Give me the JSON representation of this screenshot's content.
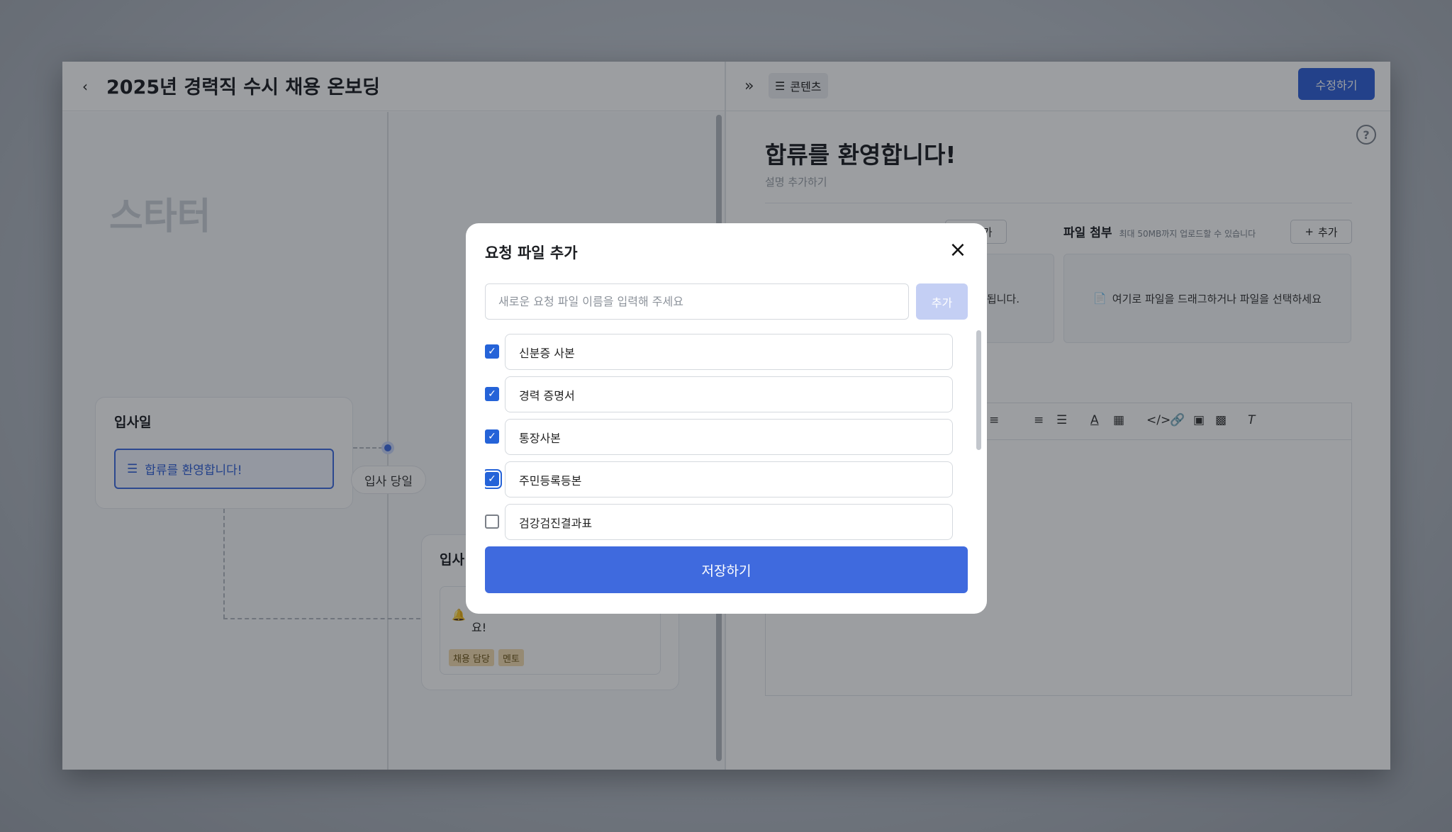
{
  "page": {
    "title": "2025년 경력직 수시 채용 온보딩",
    "back_icon": "chevron-left-icon"
  },
  "right_header": {
    "content_tab": "콘텐츠",
    "edit_button": "수정하기",
    "expand_icon": "double-chevron-right-icon"
  },
  "timeline": {
    "section_title": "스타터",
    "day_card": {
      "title": "입사일",
      "item_label": "합류를 환영합니다!"
    },
    "day_pill": "입사 당일",
    "card2": {
      "title": "입사",
      "text": "요!",
      "tags": [
        "채용 담당",
        "멘토"
      ]
    }
  },
  "content": {
    "title": "합류를 환영합니다!",
    "description_placeholder": "설명 추가하기",
    "add_label": "추가",
    "left_drop_text": "됩니다.",
    "file_attach": {
      "title": "파일 첨부",
      "hint": "최대 50MB까지 업로드할 수 있습니다",
      "drop_text": "여기로 파일을 드래그하거나 파일을 선택하세요"
    }
  },
  "modal": {
    "title": "요청 파일 추가",
    "input_placeholder": "새로운 요청 파일 이름을 입력해 주세요",
    "add_button": "추가",
    "items": [
      {
        "label": "신분증 사본",
        "checked": true
      },
      {
        "label": "경력 증명서",
        "checked": true
      },
      {
        "label": "통장사본",
        "checked": true
      },
      {
        "label": "주민등록등본",
        "checked": true
      },
      {
        "label": "검강검진결과표",
        "checked": false
      }
    ],
    "save_button": "저장하기"
  },
  "colors": {
    "primary": "#2f5fd7",
    "save": "#3f6ade",
    "add_disabled": "#c4cff4",
    "tag_bg": "#f4ddb0"
  }
}
